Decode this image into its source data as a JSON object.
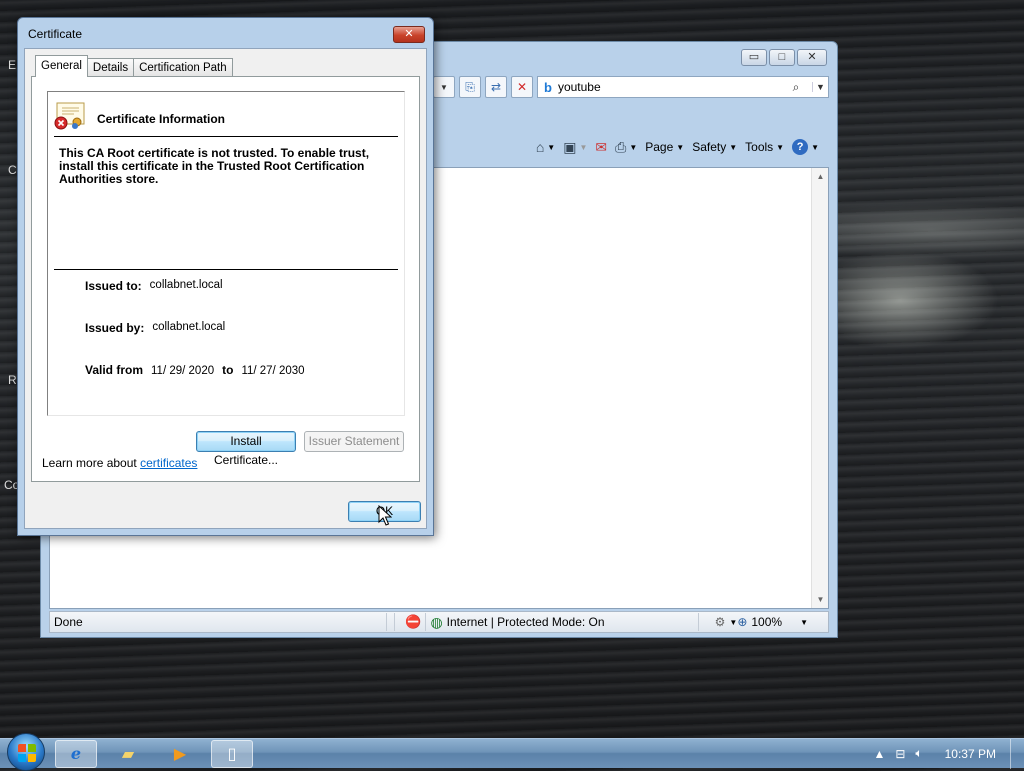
{
  "desktop": {
    "edge_labels": [
      "E",
      "C",
      "R",
      "Co"
    ]
  },
  "ie": {
    "search_value": "youtube",
    "commands": {
      "page": "Page",
      "safety": "Safety",
      "tools": "Tools"
    },
    "status": {
      "text": "Done",
      "zone": "Internet | Protected Mode: On",
      "zoom": "100%"
    }
  },
  "certificate": {
    "window_title": "Certificate",
    "tabs": [
      "General",
      "Details",
      "Certification Path"
    ],
    "info_title": "Certificate Information",
    "warning": "This CA Root certificate is not trusted. To enable trust, install this certificate in the Trusted Root Certification Authorities store.",
    "issued_to_label": "Issued to:",
    "issued_to": "collabnet.local",
    "issued_by_label": "Issued by:",
    "issued_by": "collabnet.local",
    "valid_from_label": "Valid from",
    "valid_from": "11/ 29/ 2020",
    "to_label": "to",
    "valid_to": "11/ 27/ 2030",
    "install_button": "Install Certificate...",
    "issuer_statement_button": "Issuer Statement",
    "learn_more_prefix": "Learn more about",
    "learn_more_link": "certificates",
    "ok_button": "OK"
  },
  "taskbar": {
    "clock": "10:37 PM"
  }
}
